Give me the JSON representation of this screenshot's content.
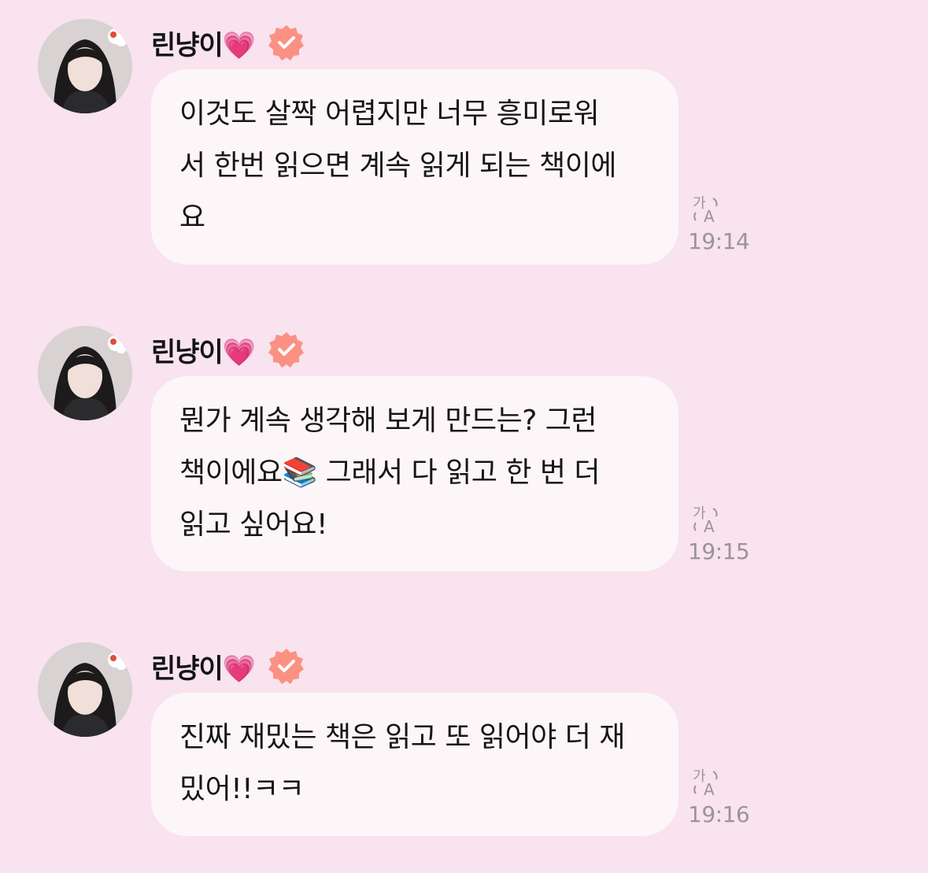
{
  "sender": {
    "name": "린냥이💗",
    "heart_icon": "pink-heart-icon",
    "badge_icon": "verified-badge-icon",
    "badge_color": "#fb9182"
  },
  "messages": [
    {
      "text": "이것도 살짝 어렵지만 너무 흥미로워\n서 한번 읽으면 계속 읽게 되는 책이에\n요",
      "time": "19:14"
    },
    {
      "text": "뭔가 계속 생각해 보게 만드는? 그런\n책이에요📚 그래서 다 읽고 한 번 더\n읽고 싶어요!",
      "time": "19:15"
    },
    {
      "text": "진짜 재밌는 책은 읽고 또 읽어야 더 재\n밌어!!ㅋㅋ",
      "time": "19:16"
    }
  ],
  "translate_icon": "translate-icon",
  "colors": {
    "background": "#f8e3ee",
    "bubble": "#fdf6f9",
    "time_text": "#9c9497"
  }
}
